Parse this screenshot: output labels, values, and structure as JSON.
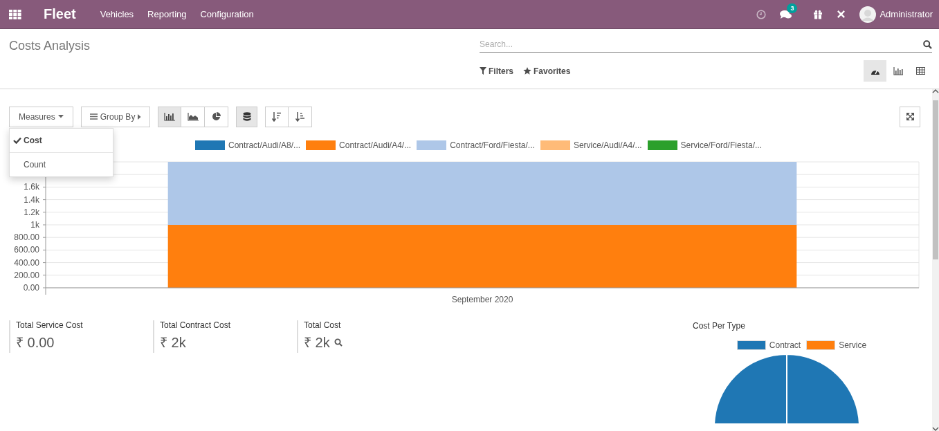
{
  "navbar": {
    "app_name": "Fleet",
    "menus": [
      "Vehicles",
      "Reporting",
      "Configuration"
    ],
    "messages_count": "3",
    "user_name": "Administrator"
  },
  "control_panel": {
    "title": "Costs Analysis",
    "search": {
      "placeholder": "Search..."
    },
    "filters": [
      "Filters",
      "Favorites"
    ],
    "views": [
      {
        "kind": "dashboard",
        "selected": true
      },
      {
        "kind": "graph",
        "selected": false
      },
      {
        "kind": "pivot",
        "selected": false
      }
    ]
  },
  "toolbar": {
    "measures_label": "Measures",
    "group_by_label": "Group By",
    "chart_types": [
      {
        "kind": "bar",
        "selected": true
      },
      {
        "kind": "line",
        "selected": false
      },
      {
        "kind": "pie",
        "selected": false
      }
    ],
    "stacked": true,
    "measures_menu": [
      {
        "label": "Cost",
        "checked": true
      },
      {
        "label": "Count",
        "checked": false
      }
    ]
  },
  "graph": {
    "chart_data": {
      "type": "bar",
      "stacked": true,
      "grid": true,
      "legend": "top",
      "categories": [
        "September 2020"
      ],
      "ylim": [
        0,
        2000
      ],
      "yticks": [
        {
          "value": 0,
          "label": "0.00"
        },
        {
          "value": 200,
          "label": "200.00"
        },
        {
          "value": 400,
          "label": "400.00"
        },
        {
          "value": 600,
          "label": "600.00"
        },
        {
          "value": 800,
          "label": "800.00"
        },
        {
          "value": 1000,
          "label": "1k"
        },
        {
          "value": 1200,
          "label": "1.2k"
        },
        {
          "value": 1400,
          "label": "1.4k"
        },
        {
          "value": 1600,
          "label": "1.6k"
        }
      ],
      "series": [
        {
          "name": "Contract/Audi/A8/...",
          "color": "#1f77b4",
          "values": [
            0
          ]
        },
        {
          "name": "Contract/Audi/A4/...",
          "color": "#ff7f0e",
          "values": [
            1000
          ]
        },
        {
          "name": "Contract/Ford/Fiesta/...",
          "color": "#aec7e8",
          "values": [
            1000
          ]
        },
        {
          "name": "Service/Audi/A4/...",
          "color": "#ffbb78",
          "values": [
            0
          ]
        },
        {
          "name": "Service/Ford/Fiesta/...",
          "color": "#2ca02c",
          "values": [
            0
          ]
        }
      ]
    }
  },
  "kpis": [
    {
      "label": "Total Service Cost",
      "value": "₹ 0.00",
      "zoomable": false
    },
    {
      "label": "Total Contract Cost",
      "value": "₹ 2k",
      "zoomable": false
    },
    {
      "label": "Total Cost",
      "value": "₹ 2k",
      "zoomable": true
    }
  ],
  "cost_per_type": {
    "title": "Cost Per Type",
    "chart_data": {
      "type": "pie",
      "legend": "top",
      "categories": [
        "Contract",
        "Service"
      ],
      "series": [
        {
          "values": [
            100,
            0
          ]
        }
      ],
      "colors": [
        "#1f77b4",
        "#ff7f0e"
      ]
    }
  }
}
